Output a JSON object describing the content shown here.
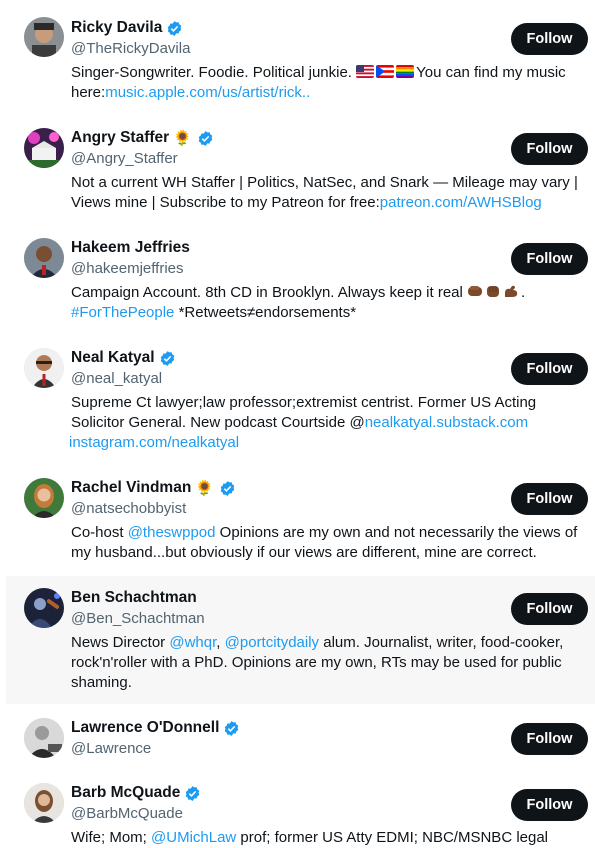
{
  "follow_label": "Follow",
  "colors": {
    "link": "#1d9bf0",
    "verified": "#1d9bf0",
    "button_bg": "#0f1419",
    "handle": "#536471",
    "highlight_row": "#f7f7f7"
  },
  "users": [
    {
      "name": "Ricky Davila",
      "handle": "@TheRickyDavila",
      "verified": true,
      "bio_parts": [
        "Singer-Songwriter. Foodie. Political junkie. ",
        "You can find my music here:",
        "music.apple.com/us/artist/rick.."
      ],
      "bio_emoji": [
        "us-flag",
        "puerto-rico-flag",
        "rainbow-flag"
      ]
    },
    {
      "name": "Angry Staffer",
      "name_emoji": "🌻",
      "handle": "@Angry_Staffer",
      "verified": true,
      "bio_parts": [
        "Not a current WH Staffer | Politics, NatSec, and Snark — Mileage may vary | Views mine | Subscribe to my Patreon for free:",
        "patreon.com/AWHSBlog"
      ]
    },
    {
      "name": "Hakeem Jeffries",
      "handle": "@hakeemjeffries",
      "verified": false,
      "bio_parts": [
        "Campaign Account. 8th CD in Brooklyn. Always keep it real ",
        ".",
        "#ForThePeople",
        " *Retweets≠endorsements*"
      ],
      "bio_emoji": [
        "fist-left",
        "fist-front",
        "flexed-biceps"
      ]
    },
    {
      "name": "Neal Katyal",
      "handle": "@neal_katyal",
      "verified": true,
      "bio_parts": [
        "Supreme Ct lawyer;law professor;extremist centrist. Former US Acting Solicitor General. New podcast Courtside @",
        "nealkatyal.substack.com",
        "instagram.com/nealkatyal"
      ]
    },
    {
      "name": "Rachel Vindman",
      "name_emoji": "🌻",
      "handle": "@natsechobbyist",
      "verified": true,
      "bio_parts": [
        "Co-host ",
        "@theswppod",
        " Opinions are my own and not necessarily the views of my husband...but obviously if our views are different, mine are correct."
      ]
    },
    {
      "name": "Ben Schachtman",
      "handle": "@Ben_Schachtman",
      "verified": false,
      "bio_parts": [
        "News Director ",
        "@whqr",
        ", ",
        "@portcitydaily",
        " alum. Journalist, writer, food-cooker, rock'n'roller with a PhD. Opinions are my own, RTs may be used for public shaming."
      ]
    },
    {
      "name": "Lawrence O'Donnell",
      "handle": "@Lawrence",
      "verified": true,
      "bio_parts": []
    },
    {
      "name": "Barb McQuade",
      "handle": "@BarbMcQuade",
      "verified": true,
      "bio_parts": [
        "Wife; Mom; ",
        "@UMichLaw",
        " prof; former US Atty EDMI; NBC/MSNBC legal"
      ]
    }
  ]
}
